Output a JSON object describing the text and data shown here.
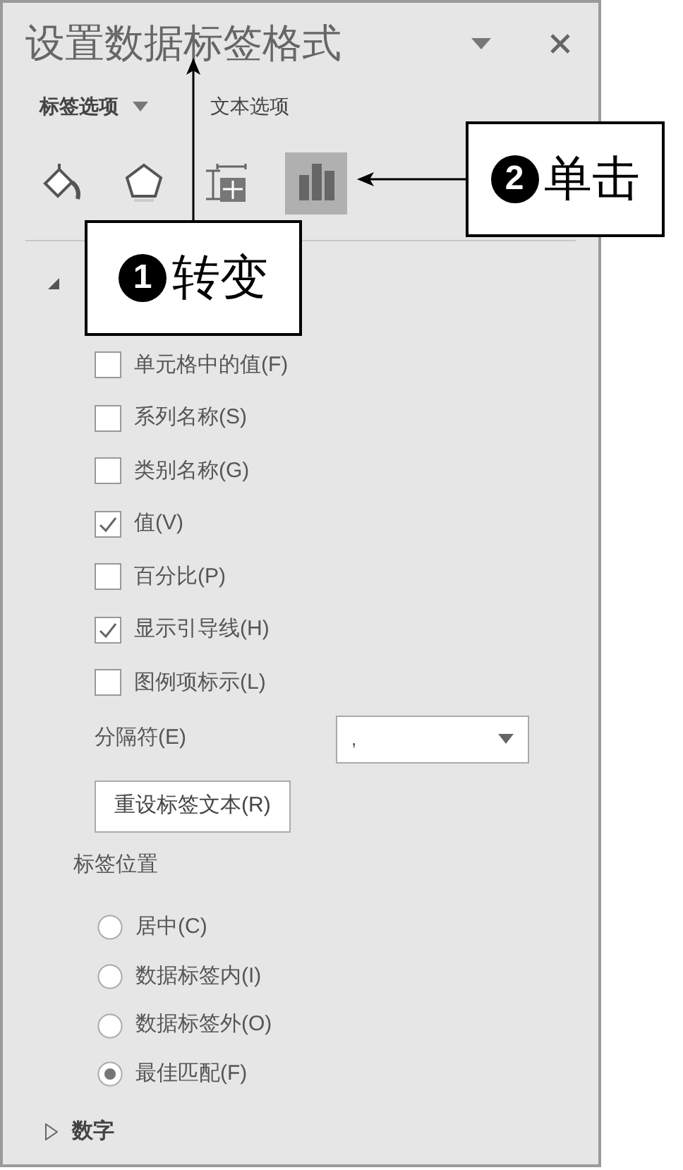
{
  "panel": {
    "title": "设置数据标签格式",
    "tabs": [
      {
        "label": "标签选项",
        "selected": true
      },
      {
        "label": "文本选项",
        "selected": false
      }
    ],
    "icon_tabs": [
      {
        "kind": "fill",
        "selected": false
      },
      {
        "kind": "effects",
        "selected": false
      },
      {
        "kind": "size",
        "selected": false
      },
      {
        "kind": "options",
        "selected": true
      }
    ],
    "label_options": {
      "expanded": true,
      "checkboxes": [
        {
          "label": "单元格中的值(F)",
          "checked": false
        },
        {
          "label": "系列名称(S)",
          "checked": false
        },
        {
          "label": "类别名称(G)",
          "checked": false
        },
        {
          "label": "值(V)",
          "checked": true
        },
        {
          "label": "百分比(P)",
          "checked": false
        },
        {
          "label": "显示引导线(H)",
          "checked": true
        },
        {
          "label": "图例项标示(L)",
          "checked": false
        }
      ],
      "separator": {
        "label": "分隔符(E)",
        "value": ","
      },
      "reset_button": "重设标签文本(R)",
      "position": {
        "title": "标签位置",
        "options": [
          {
            "label": "居中(C)",
            "selected": false
          },
          {
            "label": "数据标签内(I)",
            "selected": false
          },
          {
            "label": "数据标签外(O)",
            "selected": false
          },
          {
            "label": "最佳匹配(F)",
            "selected": true
          }
        ]
      }
    },
    "number_section": {
      "title": "数字",
      "expanded": false
    }
  },
  "callouts": [
    {
      "kind": "up",
      "number": "1",
      "text": "转变"
    },
    {
      "kind": "left",
      "number": "2",
      "text": "单击"
    }
  ]
}
